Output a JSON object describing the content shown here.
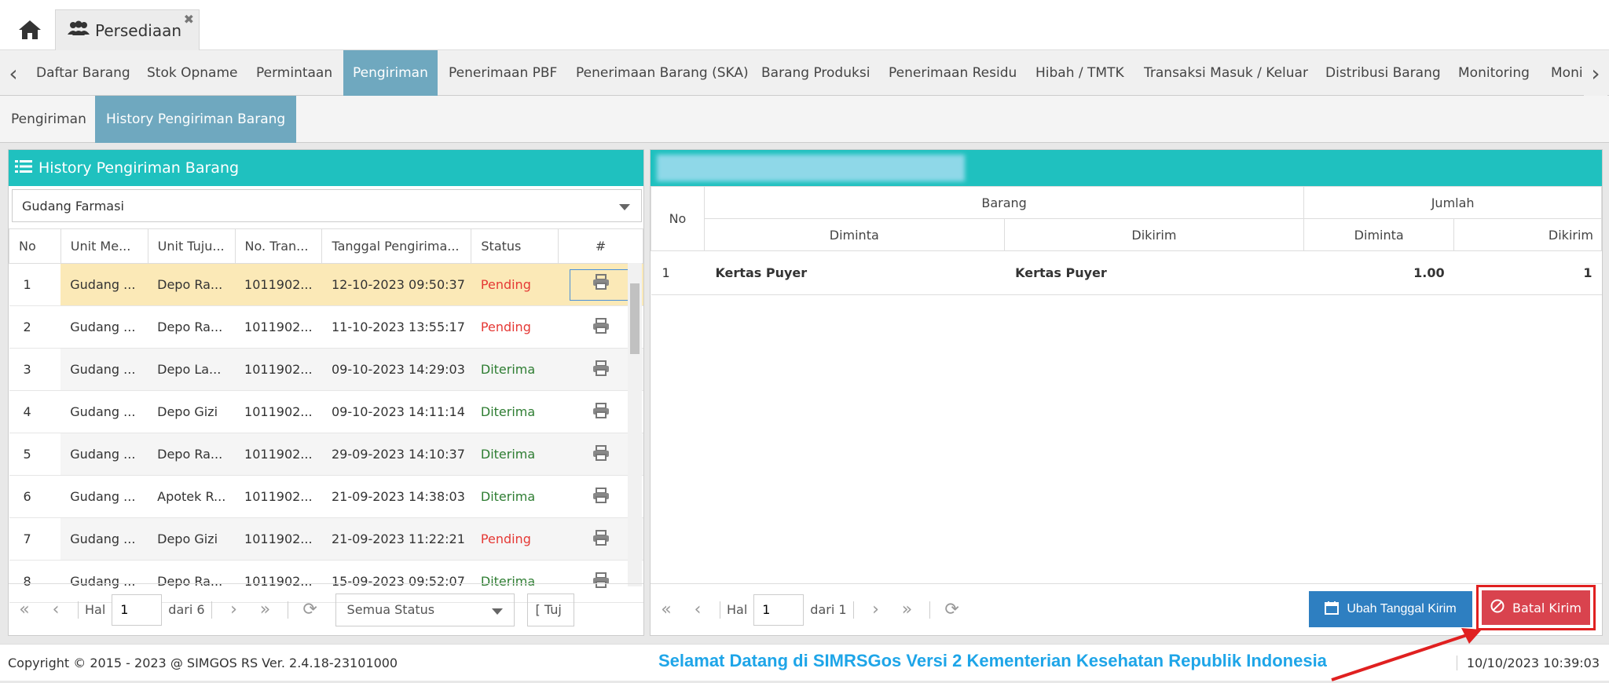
{
  "app_tab": {
    "label": "Persediaan"
  },
  "menu": {
    "items": [
      {
        "label": "Daftar Barang"
      },
      {
        "label": "Stok Opname"
      },
      {
        "label": "Permintaan"
      },
      {
        "label": "Pengiriman"
      },
      {
        "label": "Penerimaan PBF"
      },
      {
        "label": "Penerimaan Barang (SKA)"
      },
      {
        "label": "Barang Produksi"
      },
      {
        "label": "Penerimaan Residu"
      },
      {
        "label": "Hibah / TMTK"
      },
      {
        "label": "Transaksi Masuk / Keluar"
      },
      {
        "label": "Distribusi Barang"
      },
      {
        "label": "Monitoring"
      },
      {
        "label": "Moni"
      }
    ],
    "active": "Pengiriman"
  },
  "subtabs": [
    {
      "label": "Pengiriman"
    },
    {
      "label": "History Pengiriman Barang"
    }
  ],
  "left_panel": {
    "title": "History Pengiriman Barang",
    "warehouse_select": "Gudang Farmasi",
    "columns": [
      "No",
      "Unit Me...",
      "Unit Tuju...",
      "No. Tran...",
      "Tanggal Pengirima...",
      "Status",
      "#"
    ],
    "rows": [
      {
        "no": "1",
        "unit_me": "Gudang ...",
        "unit_tuju": "Depo Ra...",
        "no_tran": "1011902...",
        "tanggal": "12-10-2023 09:50:37",
        "status": "Pending"
      },
      {
        "no": "2",
        "unit_me": "Gudang ...",
        "unit_tuju": "Depo Ra...",
        "no_tran": "1011902...",
        "tanggal": "11-10-2023 13:55:17",
        "status": "Pending"
      },
      {
        "no": "3",
        "unit_me": "Gudang ...",
        "unit_tuju": "Depo La...",
        "no_tran": "1011902...",
        "tanggal": "09-10-2023 14:29:03",
        "status": "Diterima"
      },
      {
        "no": "4",
        "unit_me": "Gudang ...",
        "unit_tuju": "Depo Gizi",
        "no_tran": "1011902...",
        "tanggal": "09-10-2023 14:11:14",
        "status": "Diterima"
      },
      {
        "no": "5",
        "unit_me": "Gudang ...",
        "unit_tuju": "Depo Ra...",
        "no_tran": "1011902...",
        "tanggal": "29-09-2023 14:10:37",
        "status": "Diterima"
      },
      {
        "no": "6",
        "unit_me": "Gudang ...",
        "unit_tuju": "Apotek R...",
        "no_tran": "1011902...",
        "tanggal": "21-09-2023 14:38:03",
        "status": "Diterima"
      },
      {
        "no": "7",
        "unit_me": "Gudang ...",
        "unit_tuju": "Depo Gizi",
        "no_tran": "1011902...",
        "tanggal": "21-09-2023 11:22:21",
        "status": "Pending"
      },
      {
        "no": "8",
        "unit_me": "Gudang ...",
        "unit_tuju": "Depo Ra...",
        "no_tran": "1011902...",
        "tanggal": "15-09-2023 09:52:07",
        "status": "Diterima"
      }
    ],
    "pager": {
      "hal_label": "Hal",
      "page": "1",
      "of_label": "dari 6",
      "status_filter": "Semua Status",
      "tujuan_filter": "[ Tuj"
    }
  },
  "right_panel": {
    "group_headers": {
      "barang": "Barang",
      "jumlah": "Jumlah"
    },
    "columns": {
      "no": "No",
      "diminta": "Diminta",
      "dikirim": "Dikirim",
      "jml_diminta": "Diminta",
      "jml_dikirim": "Dikirim"
    },
    "rows": [
      {
        "no": "1",
        "diminta": "Kertas Puyer",
        "dikirim": "Kertas Puyer",
        "jml_diminta": "1.00",
        "jml_dikirim": "1"
      }
    ],
    "pager": {
      "hal_label": "Hal",
      "page": "1",
      "of_label": "dari 1"
    },
    "buttons": {
      "ubah": "Ubah Tanggal Kirim",
      "batal": "Batal Kirim"
    }
  },
  "footer": {
    "copyright": "Copyright © 2015 - 2023 @ SIMGOS RS Ver. 2.4.18-23101000",
    "welcome": "Selamat Datang di SIMRSGos Versi 2 Kementerian Kesehatan Republik Indonesia",
    "datetime": "10/10/2023 10:39:03"
  },
  "colors": {
    "teal": "#1fc1bf",
    "menu_active": "#6fa8bf",
    "pending": "#e53935",
    "diterima": "#2e7d32",
    "danger": "#d9434e",
    "primary": "#2e7fc1",
    "highlight": "#e02020"
  }
}
